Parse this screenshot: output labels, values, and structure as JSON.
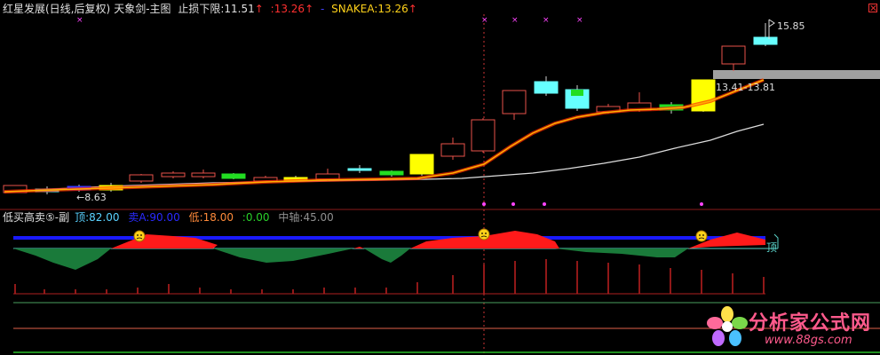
{
  "main_panel": {
    "stock_name": "红星发展(日线,后复权)",
    "indicator_name": "天象剑-主图",
    "stop_loss_label": "止损下限:",
    "stop_loss_value": "11.51",
    "second_value": ":13.26",
    "snake_label": "SNAKEA:",
    "snake_value": "13.26",
    "up_arrow": "↑",
    "low_marker": "←8.63",
    "high_marker": "15.85",
    "range_label": "13.41-13.81"
  },
  "sub_panel": {
    "title": "低买高卖⑤-副",
    "top_label": "顶:",
    "top_value": "82.00",
    "sell_label": "卖A:",
    "sell_value": "90.00",
    "low_label": "低:",
    "low_value": "18.00",
    "zero_value": ":0.00",
    "axis_label": "中轴:",
    "axis_value": "45.00",
    "side_tag": "顶"
  },
  "watermark": {
    "title": "分析家公式网",
    "url": "www.88gs.com"
  },
  "colors": {
    "background": "#000000",
    "candle_up": "#e8524a",
    "candle_yellow": "#ffff00",
    "candle_cyan": "#66ffff",
    "candle_green": "#22dd22",
    "snake_line": "#ff5a1a",
    "slow_line": "#dddddd",
    "red_band": "#ff1a1a",
    "green_band": "#1a7a3a",
    "blue_line": "#1a1aff",
    "magenta_marker": "#ff44ff",
    "watermark": "#ff5a8c"
  }
}
